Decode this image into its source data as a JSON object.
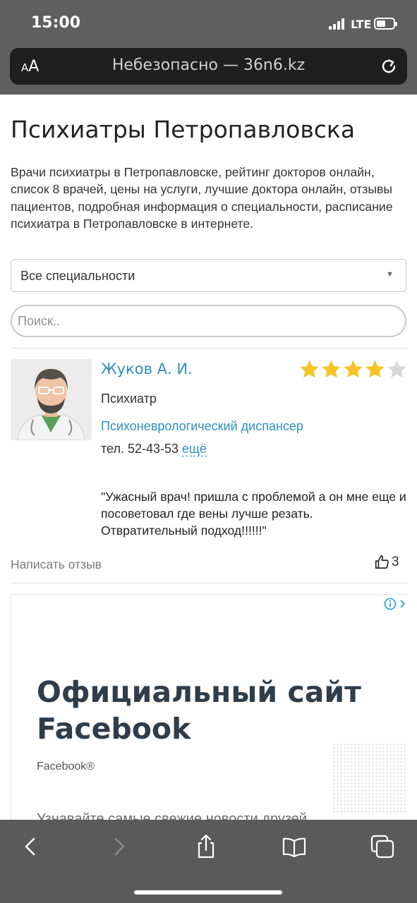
{
  "status_bar": {
    "time": "15:00",
    "network": "LTE"
  },
  "browser": {
    "text_size_label": "AA",
    "url": "Небезопасно — 36n6.kz"
  },
  "page": {
    "title": "Психиатры Петропавловска",
    "intro": "Врачи психиатры в Петропавловске, рейтинг докторов онлайн, список 8 врачей, цены на услуги, лучшие доктора онлайн, отзывы пациентов, подробная информация о специальности, расписание психиатра в Петропавловске в интернете.",
    "specialty_select": {
      "value": "Все специальности"
    },
    "search": {
      "placeholder": "Поиск.."
    }
  },
  "doctor": {
    "name": "Жуков А. И.",
    "rating": 4,
    "rating_max": 5,
    "specialty": "Психиатр",
    "clinic": "Психоневрологический диспансер",
    "phone": "тел. 52-43-53",
    "more_link": "ещё",
    "review": "\"Ужасный врач! пришла с проблемой а он мне еще и посоветовал где вены лучше резать. Отвратительный подход!!!!!!\"",
    "write_review": "Написать отзыв",
    "likes": "3"
  },
  "ad": {
    "title": "Официальный сайт Facebook",
    "brand": "Facebook®",
    "cut_text": "Узнавайте самые свежие новости друзей"
  },
  "colors": {
    "link": "#2e8fbf",
    "star": "#f7c325",
    "chrome": "#5f5f5f"
  }
}
